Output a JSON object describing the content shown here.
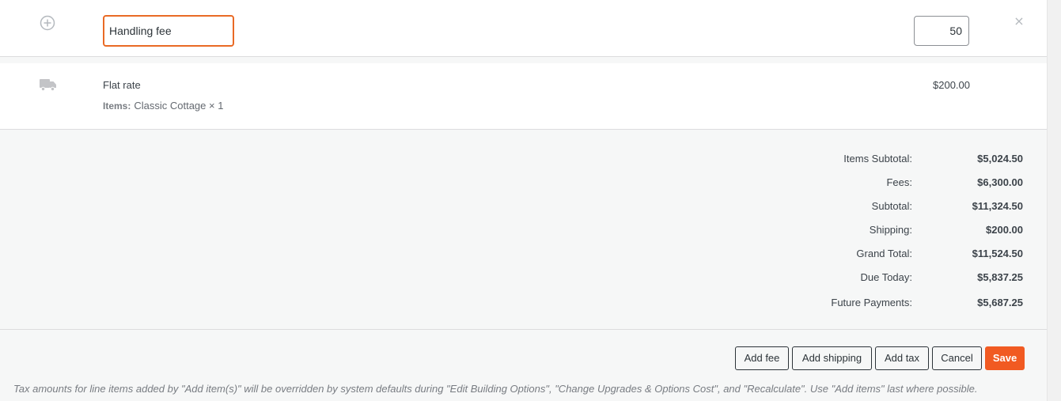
{
  "fee_row": {
    "add_icon": "plus-circle-icon",
    "name_value": "Handling fee",
    "amount_value": "50",
    "remove_glyph": "×",
    "remove_icon": "close-icon"
  },
  "shipping_row": {
    "icon": "truck-icon",
    "method": "Flat rate",
    "items_label": "Items:",
    "items_value": "Classic Cottage × 1",
    "amount": "$200.00"
  },
  "totals": [
    {
      "label": "Items Subtotal:",
      "value": "$5,024.50"
    },
    {
      "label": "Fees:",
      "value": "$6,300.00"
    },
    {
      "label": "Subtotal:",
      "value": "$11,324.50"
    },
    {
      "label": "Shipping:",
      "value": "$200.00"
    },
    {
      "label": "Grand Total:",
      "value": "$11,524.50"
    },
    {
      "label": "Due Today:",
      "value": "$5,837.25"
    },
    {
      "label": "Future Payments:",
      "value": "$5,687.25"
    }
  ],
  "actions": {
    "add_fee": "Add fee",
    "add_shipping": "Add shipping",
    "add_tax": "Add tax",
    "cancel": "Cancel",
    "save": "Save"
  },
  "notice": "Tax amounts for line items added by \"Add item(s)\" will be overridden by system defaults during \"Edit Building Options\", \"Change Upgrades & Options Cost\", and \"Recalculate\". Use \"Add items\" last where possible.",
  "colors": {
    "accent": "#f15a22",
    "focus_border": "#e96a25",
    "panel_bg": "#f6f7f7"
  }
}
